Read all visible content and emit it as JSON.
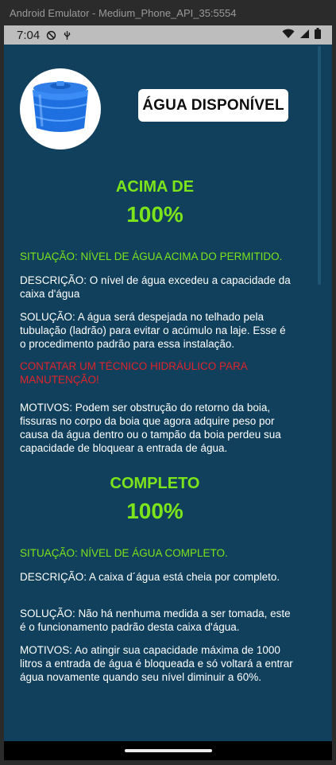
{
  "window": {
    "title": "Android Emulator - Medium_Phone_API_35:5554"
  },
  "status_bar": {
    "time": "7:04"
  },
  "header": {
    "availability_label": "ÁGUA DISPONÍVEL"
  },
  "sections": [
    {
      "label": "ACIMA DE",
      "percent": "100%",
      "situacao": "SITUAÇÃO: NÍVEL DE ÁGUA ACIMA DO PERMITIDO.",
      "descricao": "DESCRIÇÃO: O nível de água excedeu a capacidade da caixa d'água",
      "solucao": "SOLUÇÃO: A água será despejada no telhado pela tubulação (ladrão) para evitar o acúmulo na laje. Esse é o procedimento padrão para essa instalação.",
      "alerta": "CONTATAR UM TÉCNICO HIDRÁULICO PARA MANUTENÇÃO!",
      "motivos": "MOTIVOS: Podem ser obstrução do retorno da boia, fissuras no corpo da boia que agora adquire peso por causa da água dentro ou o tampão da boia perdeu sua capacidade de bloquear a entrada de água."
    },
    {
      "label": "COMPLETO",
      "percent": "100%",
      "situacao": "SITUAÇÃO: NÍVEL DE ÁGUA COMPLETO.",
      "descricao": "DESCRIÇÃO:  A caixa d´água está cheia por completo.",
      "solucao": "SOLUÇÃO: Não há nenhuma medida a ser tomada, este é o funcionamento padrão desta caixa d'água.",
      "motivos": "MOTIVOS: Ao atingir sua capacidade máxima de 1000 litros a entrada de água é bloqueada e só voltará a entrar água novamente quando seu nível diminuir a 60%."
    }
  ],
  "colors": {
    "background": "#11405c",
    "accent_green": "#7be41a",
    "alert_red": "#e0242a"
  },
  "icons": {
    "header_image": "water-tank-icon",
    "status_left": [
      "do-not-disturb-icon",
      "usb-debug-icon"
    ],
    "status_right": [
      "wifi-icon",
      "signal-icon",
      "battery-icon"
    ]
  }
}
